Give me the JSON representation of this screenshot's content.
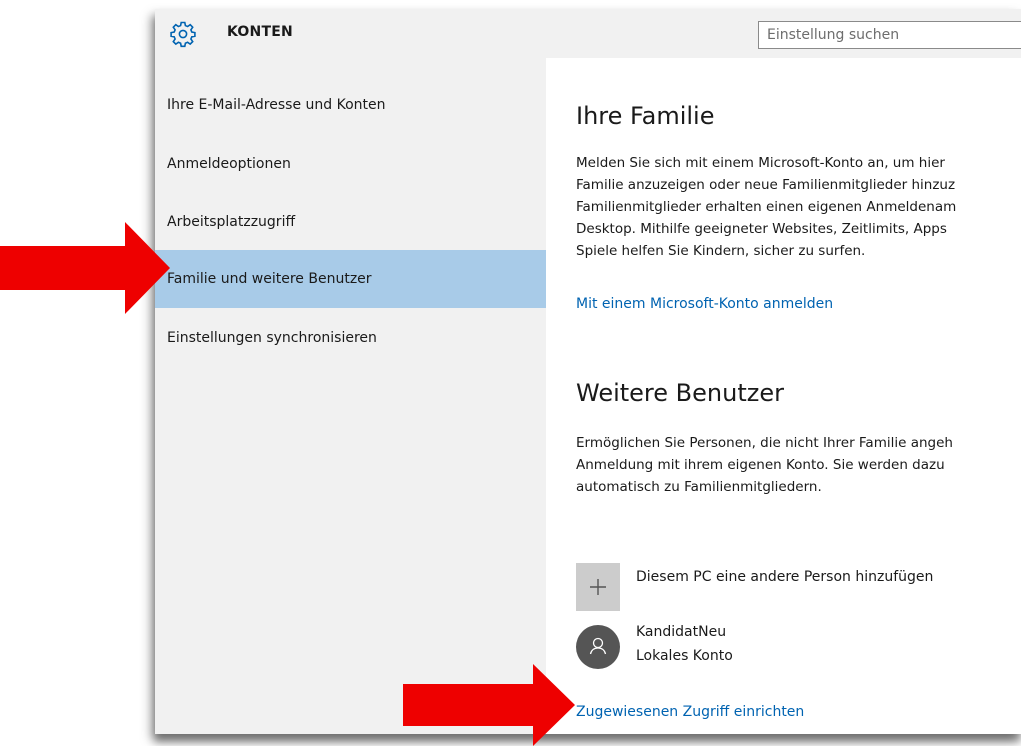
{
  "app": {
    "title": "KONTEN",
    "icon": "gear-icon"
  },
  "search": {
    "placeholder": "Einstellung suchen"
  },
  "sidebar": {
    "items": [
      {
        "label": "Ihre E-Mail-Adresse und Konten"
      },
      {
        "label": "Anmeldeoptionen"
      },
      {
        "label": "Arbeitsplatzzugriff"
      },
      {
        "label": "Familie und weitere Benutzer",
        "selected": true
      },
      {
        "label": "Einstellungen synchronisieren"
      }
    ]
  },
  "family": {
    "heading": "Ihre Familie",
    "lines": [
      "Melden Sie sich mit einem Microsoft-Konto an, um hier",
      "Familie anzuzeigen oder neue Familienmitglieder hinzuz",
      "Familienmitglieder erhalten einen eigenen Anmeldenam",
      "Desktop. Mithilfe geeigneter Websites, Zeitlimits, Apps",
      "Spiele helfen Sie Kindern, sicher zu surfen."
    ],
    "signin_link": "Mit einem Microsoft-Konto anmelden"
  },
  "others": {
    "heading": "Weitere Benutzer",
    "lines": [
      "Ermöglichen Sie Personen, die nicht Ihrer Familie angeh",
      "Anmeldung mit ihrem eigenen Konto. Sie werden dazu",
      "automatisch zu Familienmitgliedern."
    ],
    "add_person_label": "Diesem PC eine andere Person hinzufügen",
    "user": {
      "name": "KandidatNeu",
      "type": "Lokales Konto"
    },
    "assigned_access_link": "Zugewiesenen Zugriff einrichten"
  },
  "colors": {
    "sidebar_bg": "#f1f1f1",
    "selected_bg": "#a8cbe8",
    "link": "#0063b1",
    "arrow": "#ee0000"
  }
}
